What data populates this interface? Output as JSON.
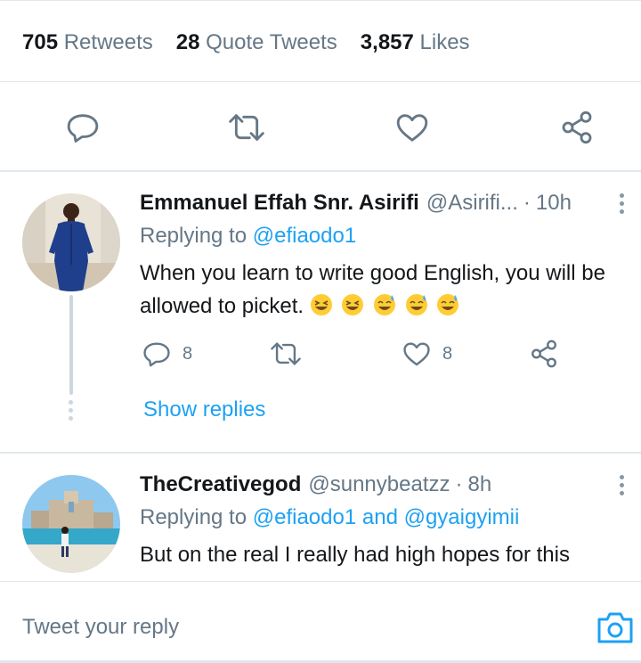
{
  "stats": {
    "retweets_count": "705",
    "retweets_label": "Retweets",
    "quotes_count": "28",
    "quotes_label": "Quote Tweets",
    "likes_count": "3,857",
    "likes_label": "Likes"
  },
  "actions": [
    "reply-icon",
    "retweet-icon",
    "like-icon",
    "share-icon"
  ],
  "replies": [
    {
      "name": "Emmanuel Effah Snr. Asirifi",
      "handle": "@Asirifi...",
      "separator": "·",
      "time": "10h",
      "replying_prefix": "Replying to",
      "replying_to": "@efiaodo1",
      "text": "When you learn to write good English, you will be allowed to picket.",
      "reply_count": "8",
      "like_count": "8",
      "show_replies": "Show replies"
    },
    {
      "name": "TheCreativegod",
      "handle": "@sunnybeatzz",
      "separator": "·",
      "time": "8h",
      "replying_prefix": "Replying to",
      "replying_to_1": "@efiaodo1",
      "replying_and": "and",
      "replying_to_2": "@gyaigyimii",
      "text": "But on the real I really had high hopes for this"
    }
  ],
  "composer": {
    "placeholder": "Tweet your reply"
  },
  "colors": {
    "accent": "#1da1f2",
    "secondary_text": "#657786",
    "border": "#e1e8ed",
    "primary_text": "#14171a"
  }
}
